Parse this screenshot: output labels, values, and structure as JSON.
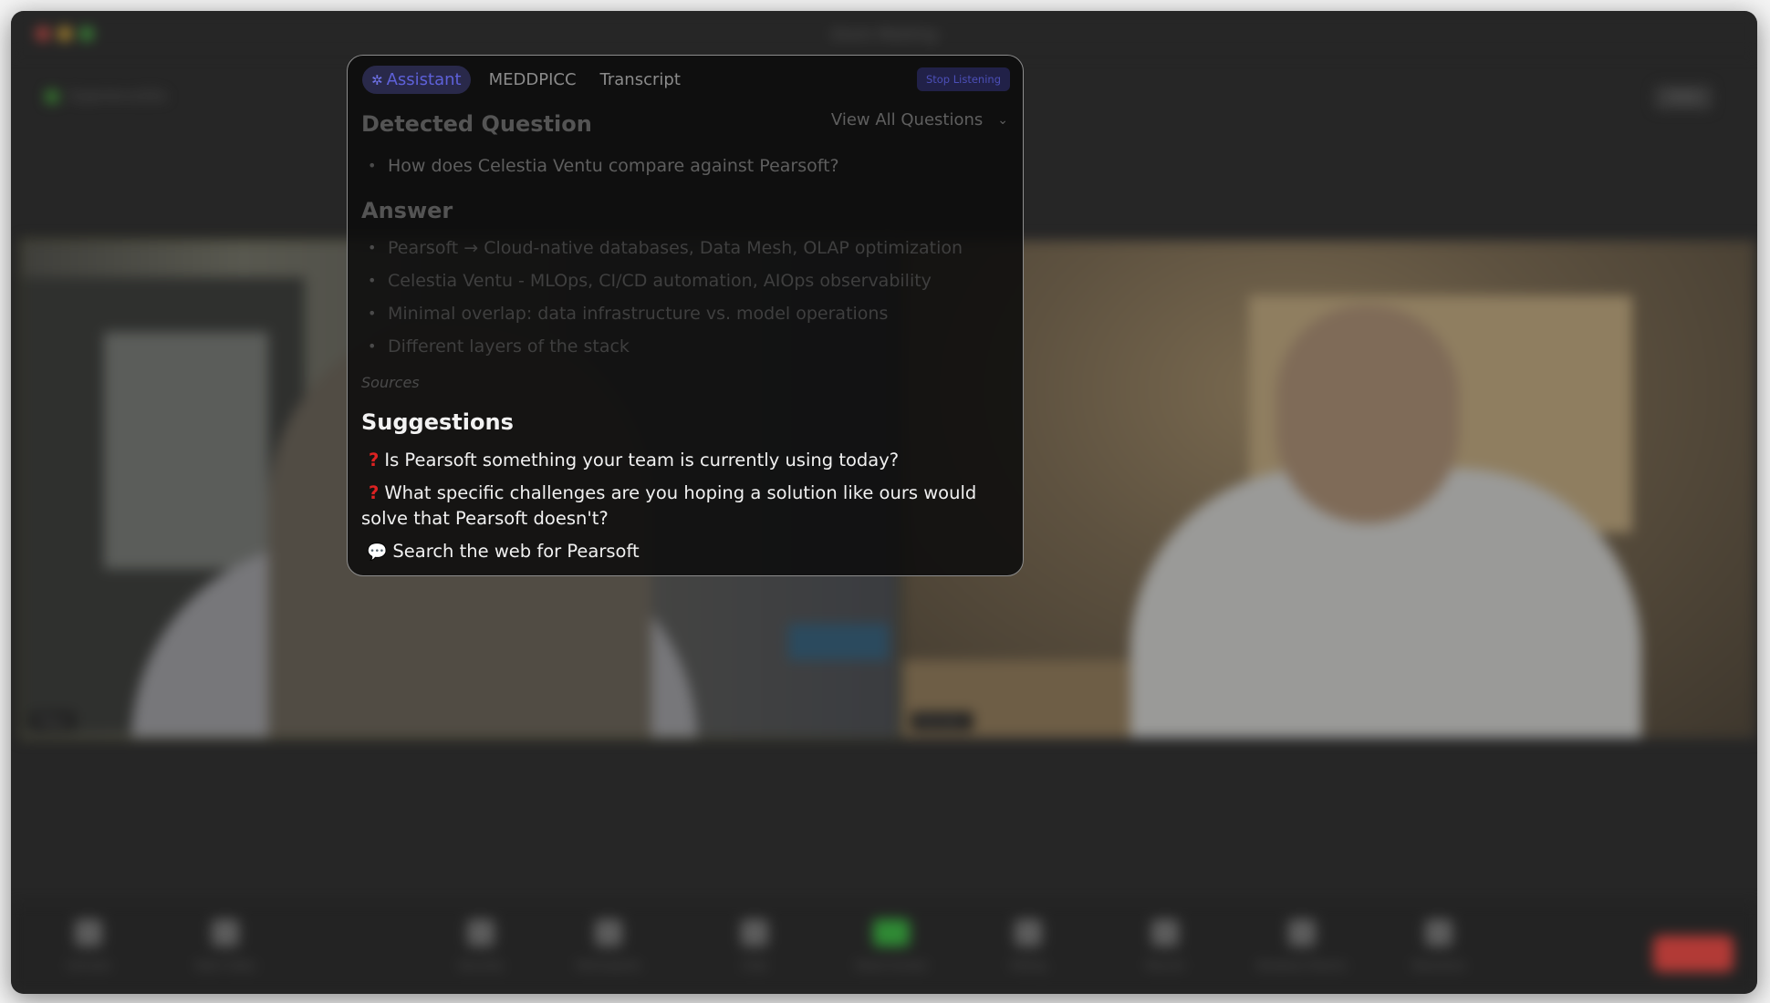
{
  "window": {
    "title": "Zoom Meeting"
  },
  "meeting": {
    "status_text": "Experience2Go",
    "view_label": "View"
  },
  "participants": [
    {
      "name": "Maya"
    },
    {
      "name": "Brandon"
    }
  ],
  "toolbar": {
    "items": [
      {
        "label": "Unmute"
      },
      {
        "label": "Start Video"
      },
      {
        "label": "Security"
      },
      {
        "label": "Participants"
      },
      {
        "label": "Chat"
      },
      {
        "label": "Share Screen"
      },
      {
        "label": "Polling"
      },
      {
        "label": "Record"
      },
      {
        "label": "Breakout Rooms"
      },
      {
        "label": "Reactions"
      }
    ],
    "end_label": "End"
  },
  "assistant": {
    "tabs": [
      {
        "label": "Assistant",
        "active": true,
        "icon": "sparkle-icon"
      },
      {
        "label": "MEDDPICC",
        "active": false
      },
      {
        "label": "Transcript",
        "active": false
      }
    ],
    "stop_listening_label": "Stop Listening",
    "view_all_label": "View All Questions",
    "detected_heading": "Detected Question",
    "detected_questions": [
      "How does Celestia Ventu compare against Pearsoft?"
    ],
    "answer_heading": "Answer",
    "answers": [
      "Pearsoft → Cloud-native databases, Data Mesh, OLAP optimization",
      "Celestia Ventu - MLOps, CI/CD automation, AIOps observability",
      "Minimal overlap: data infrastructure vs. model operations",
      "Different layers of the stack"
    ],
    "sources_label": "Sources",
    "suggestions_heading": "Suggestions",
    "suggestions": [
      {
        "icon": "question-mark-icon",
        "text": "Is Pearsoft something your team is currently using today?"
      },
      {
        "icon": "question-mark-icon",
        "text": "What specific challenges are you hoping a solution like ours would solve that Pearsoft doesn't?"
      },
      {
        "icon": "speech-bubble-icon",
        "text": "Search the web for Pearsoft"
      }
    ],
    "colors": {
      "accent": "#5e61d9",
      "question_icon": "#dd2222"
    }
  }
}
